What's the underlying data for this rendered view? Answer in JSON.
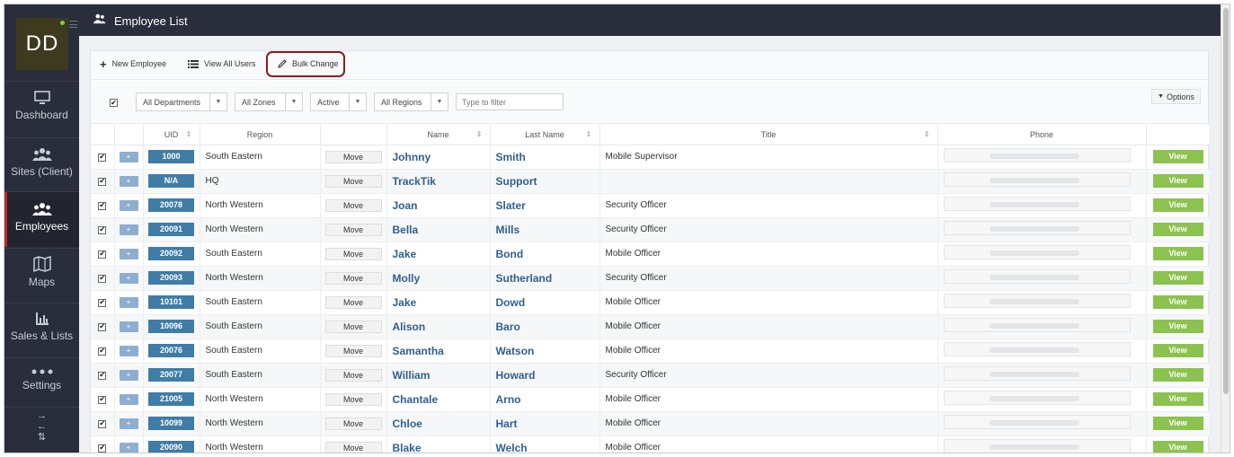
{
  "app": {
    "avatar_initials": "DD",
    "page_title": "Employee List"
  },
  "sidebar": {
    "items": [
      {
        "label": "Dashboard",
        "icon": "monitor-icon"
      },
      {
        "label": "Sites (Client)",
        "icon": "users-group-icon"
      },
      {
        "label": "Employees",
        "icon": "users-group-icon",
        "active": true
      },
      {
        "label": "Maps",
        "icon": "map-icon"
      },
      {
        "label": "Sales & Lists",
        "icon": "bar-chart-icon"
      },
      {
        "label": "Settings",
        "icon": "dots-icon"
      }
    ]
  },
  "toolbar": {
    "new_employee": "New Employee",
    "view_all_users": "View All Users",
    "bulk_change": "Bulk Change"
  },
  "filters": {
    "department": "All Departments",
    "zone": "All Zones",
    "status": "Active",
    "region": "All Regions",
    "search_placeholder": "Type to filter",
    "options": "Options"
  },
  "table": {
    "headers": {
      "uid": "UID",
      "region": "Region",
      "name": "Name",
      "last_name": "Last Name",
      "title": "Title",
      "phone": "Phone"
    },
    "plus_label": "+",
    "move_label": "Move",
    "view_label": "View",
    "rows": [
      {
        "uid": "1000",
        "region": "South Eastern",
        "name": "Johnny",
        "last_name": "Smith",
        "title": "Mobile Supervisor"
      },
      {
        "uid": "N/A",
        "region": "HQ",
        "name": "TrackTik",
        "last_name": "Support",
        "title": ""
      },
      {
        "uid": "20078",
        "region": "North Western",
        "name": "Joan",
        "last_name": "Slater",
        "title": "Security Officer"
      },
      {
        "uid": "20091",
        "region": "North Western",
        "name": "Bella",
        "last_name": "Mills",
        "title": "Security Officer"
      },
      {
        "uid": "20092",
        "region": "South Eastern",
        "name": "Jake",
        "last_name": "Bond",
        "title": "Mobile Officer"
      },
      {
        "uid": "20093",
        "region": "North Western",
        "name": "Molly",
        "last_name": "Sutherland",
        "title": "Security Officer"
      },
      {
        "uid": "10101",
        "region": "South Eastern",
        "name": "Jake",
        "last_name": "Dowd",
        "title": "Mobile Officer"
      },
      {
        "uid": "10096",
        "region": "South Eastern",
        "name": "Alison",
        "last_name": "Baro",
        "title": "Mobile Officer"
      },
      {
        "uid": "20076",
        "region": "South Eastern",
        "name": "Samantha",
        "last_name": "Watson",
        "title": "Mobile Officer"
      },
      {
        "uid": "20077",
        "region": "South Eastern",
        "name": "William",
        "last_name": "Howard",
        "title": "Security Officer"
      },
      {
        "uid": "21005",
        "region": "North Western",
        "name": "Chantale",
        "last_name": "Arno",
        "title": "Mobile Officer"
      },
      {
        "uid": "10099",
        "region": "North Western",
        "name": "Chloe",
        "last_name": "Hart",
        "title": "Mobile Officer"
      },
      {
        "uid": "20090",
        "region": "North Western",
        "name": "Blake",
        "last_name": "Welch",
        "title": "Mobile Officer"
      }
    ]
  },
  "colors": {
    "sidebar_bg": "#2a2e3c",
    "active_accent": "#c0262e",
    "uid_badge": "#3f7ca6",
    "view_button": "#8cc24f",
    "name_link": "#2f5f8f",
    "highlight_border": "#8a1b22"
  }
}
